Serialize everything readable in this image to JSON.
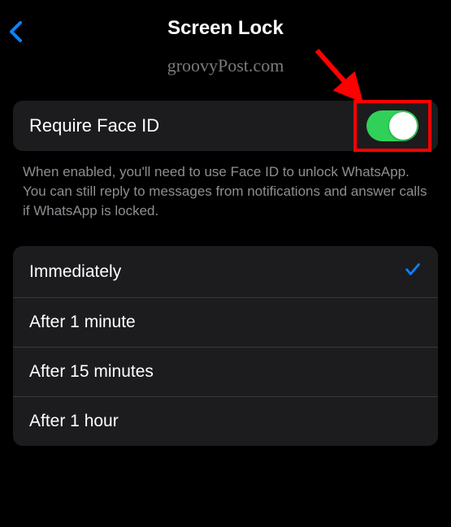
{
  "header": {
    "title": "Screen Lock"
  },
  "watermark": "groovyPost.com",
  "setting": {
    "label": "Require Face ID",
    "enabled": true
  },
  "description": "When enabled, you'll need to use Face ID to unlock WhatsApp. You can still reply to messages from notifications and answer calls if WhatsApp is locked.",
  "options": [
    {
      "label": "Immediately",
      "selected": true
    },
    {
      "label": "After 1 minute",
      "selected": false
    },
    {
      "label": "After 15 minutes",
      "selected": false
    },
    {
      "label": "After 1 hour",
      "selected": false
    }
  ],
  "colors": {
    "toggle_on": "#30d158",
    "accent": "#0a84ff",
    "highlight": "#ff0000"
  }
}
